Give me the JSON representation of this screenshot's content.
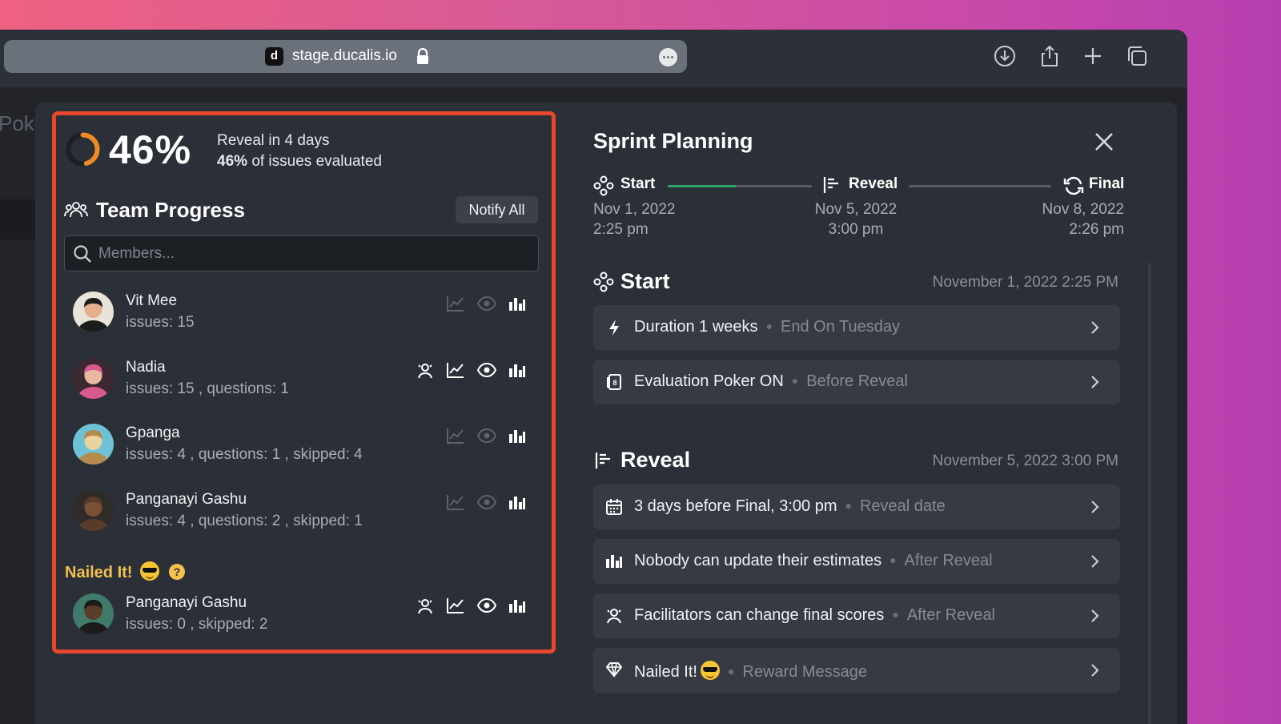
{
  "browser": {
    "site_badge": "d",
    "url": "stage.ducalis.io",
    "bg_hint": "Poke"
  },
  "progress": {
    "percent": 46,
    "percent_label": "46%",
    "reveal_in": "Reveal in 4 days",
    "evaluated_pct": "46%",
    "evaluated_suffix": "of issues evaluated"
  },
  "team": {
    "title": "Team Progress",
    "notify_label": "Notify All",
    "search_placeholder": "Members..."
  },
  "members": [
    {
      "name": "Vit Mee",
      "stats": "issues: 15",
      "facilitator": false,
      "chart_active": false,
      "eye_active": false
    },
    {
      "name": "Nadia",
      "stats": "issues: 15 , questions: 1",
      "facilitator": true,
      "chart_active": true,
      "eye_active": true
    },
    {
      "name": "Gpanga",
      "stats": "issues: 4 , questions: 1 , skipped: 4",
      "facilitator": false,
      "chart_active": false,
      "eye_active": false
    },
    {
      "name": "Panganayi Gashu",
      "stats": "issues: 4 , questions: 2 , skipped: 1",
      "facilitator": false,
      "chart_active": false,
      "eye_active": false
    }
  ],
  "nailed": {
    "label": "Nailed It!",
    "help": "?",
    "member": {
      "name": "Panganayi Gashu",
      "stats": "issues: 0 , skipped: 2",
      "facilitator": true,
      "chart_active": true,
      "eye_active": true
    }
  },
  "sprint": {
    "title": "Sprint Planning",
    "timeline": [
      {
        "label": "Start",
        "date": "Nov 1, 2022",
        "time": "2:25 pm"
      },
      {
        "label": "Reveal",
        "date": "Nov 5, 2022",
        "time": "3:00 pm"
      },
      {
        "label": "Final",
        "date": "Nov 8, 2022",
        "time": "2:26 pm"
      }
    ],
    "progress_start_to_reveal": 0.47,
    "start_section": {
      "title": "Start",
      "date": "November 1, 2022 2:25 PM",
      "rows": [
        {
          "icon": "bolt-icon",
          "main": "Duration 1 weeks",
          "sub": "End On Tuesday"
        },
        {
          "icon": "card-icon",
          "main": "Evaluation Poker ON",
          "sub": "Before Reveal"
        }
      ]
    },
    "reveal_section": {
      "title": "Reveal",
      "date": "November 5, 2022 3:00 PM",
      "rows": [
        {
          "icon": "calendar-icon",
          "main": "3 days before Final, 3:00 pm",
          "sub": "Reveal date"
        },
        {
          "icon": "bars-icon",
          "main": "Nobody can update their estimates",
          "sub": "After Reveal"
        },
        {
          "icon": "facilitator-icon",
          "main": "Facilitators can change final scores",
          "sub": "After Reveal"
        },
        {
          "icon": "gem-icon",
          "main": "Nailed It!",
          "sub": "Reward Message"
        }
      ]
    }
  },
  "colors": {
    "accent_green": "#2ea56b",
    "highlight_border": "#e8472e",
    "ring_orange": "#f08a24",
    "nailed_yellow": "#f2c14e"
  }
}
